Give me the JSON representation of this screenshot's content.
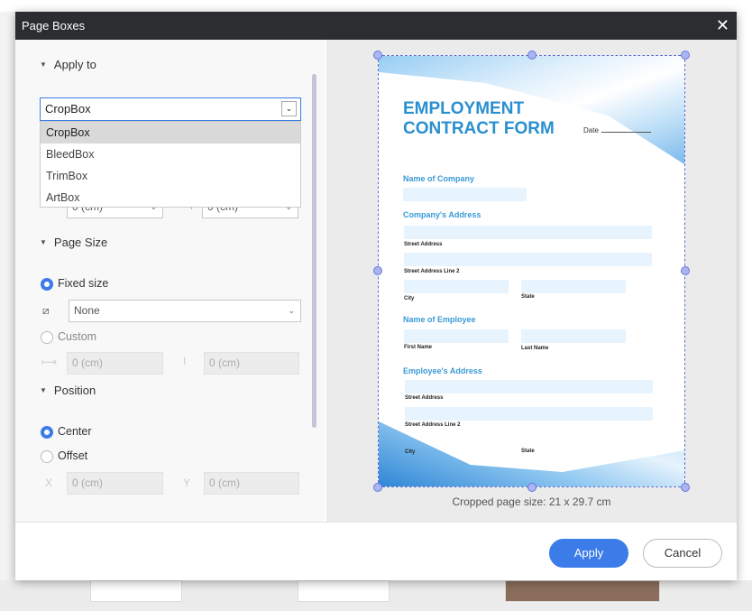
{
  "dialog": {
    "title": "Page Boxes",
    "close_icon": "close-icon"
  },
  "apply_to": {
    "heading": "Apply to",
    "selected": "CropBox",
    "options": [
      "CropBox",
      "BleedBox",
      "TrimBox",
      "ArtBox"
    ],
    "margin_bottom": "0 (cm)",
    "margin_right": "0 (cm)"
  },
  "page_size": {
    "heading": "Page Size",
    "fixed_label": "Fixed size",
    "fixed_value": "None",
    "custom_label": "Custom",
    "width": "0 (cm)",
    "height": "0 (cm)",
    "mode": "fixed"
  },
  "position": {
    "heading": "Position",
    "center_label": "Center",
    "offset_label": "Offset",
    "x_label": "X",
    "y_label": "Y",
    "x": "0 (cm)",
    "y": "0 (cm)",
    "mode": "center"
  },
  "preview": {
    "title_line1": "EMPLOYMENT",
    "title_line2": "CONTRACT FORM",
    "date_label": "Date",
    "name_of_company": "Name of Company",
    "company_address": "Company's Address",
    "street_address": "Street Address",
    "street_address_2": "Street Address Line 2",
    "city": "City",
    "state": "State",
    "name_of_employee": "Name of Employee",
    "first_name": "First Name",
    "last_name": "Last Name",
    "employee_address": "Employee's Address",
    "cropped_size": "Cropped page size: 21 x 29.7 cm"
  },
  "buttons": {
    "apply": "Apply",
    "cancel": "Cancel"
  },
  "colors": {
    "accent": "#3b7ce8",
    "titlebar": "#2b2d30",
    "form_heading": "#2a8fd0"
  }
}
